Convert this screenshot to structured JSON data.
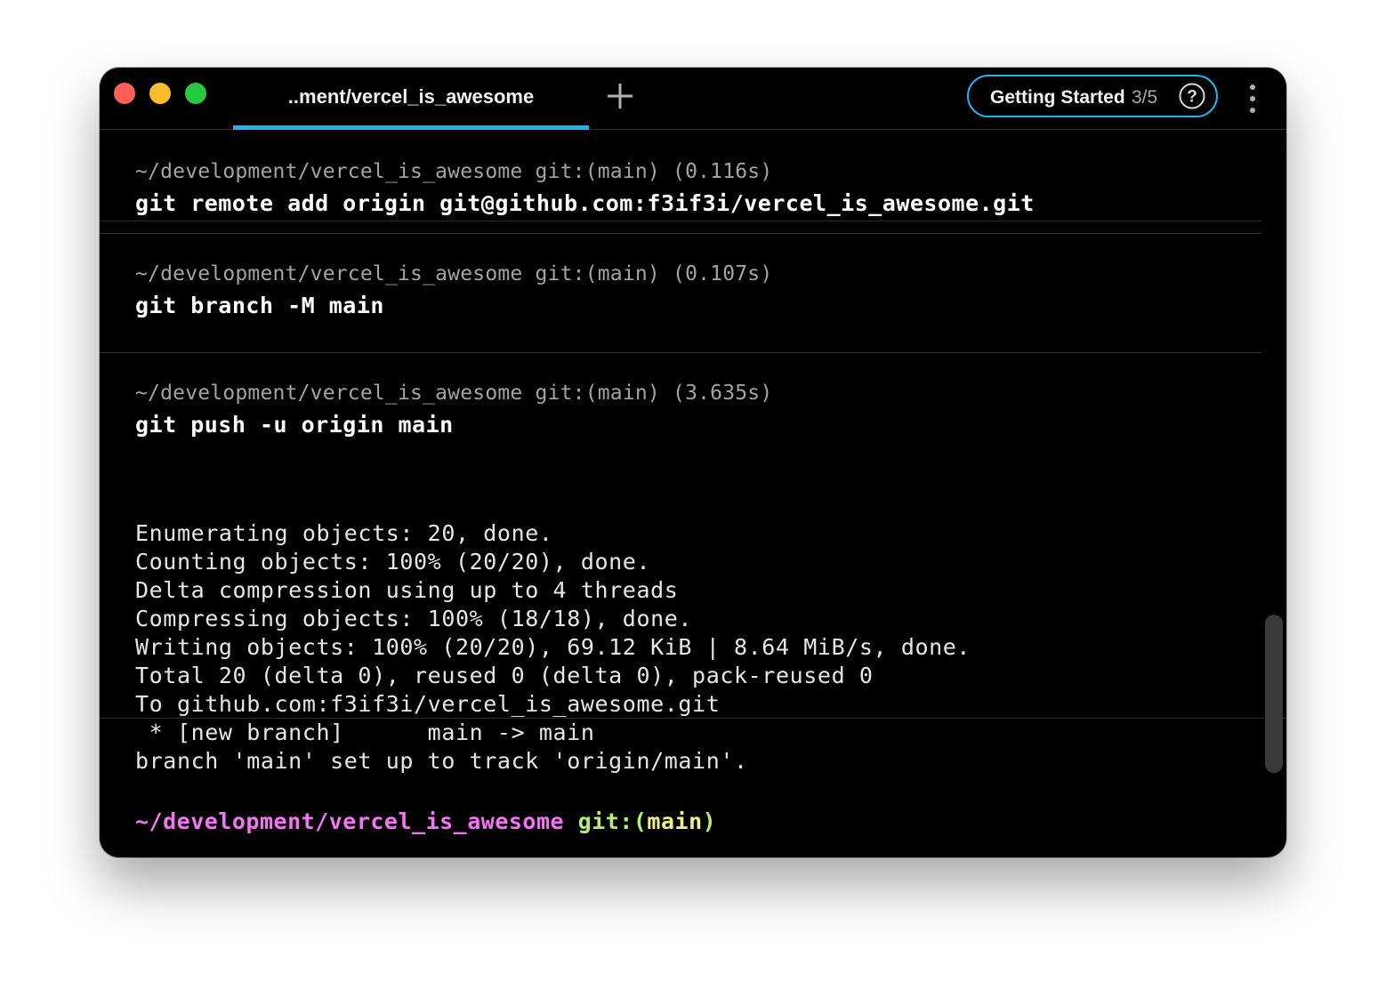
{
  "window": {
    "tab_title": "..ment/vercel_is_awesome",
    "getting_started": {
      "label": "Getting Started",
      "progress": "3/5"
    },
    "colors": {
      "accent": "#1fb4ef",
      "close": "#ff5f57",
      "minimize": "#febc2e",
      "maximize": "#28c840"
    },
    "icons": {
      "new_tab": "plus-icon",
      "help": "question-circle-icon",
      "menu": "vertical-ellipsis-icon"
    }
  },
  "blocks": [
    {
      "prompt": "~/development/vercel_is_awesome git:(main) (0.116s)",
      "command": "git remote add origin git@github.com:f3if3i/vercel_is_awesome.git"
    },
    {
      "prompt": "~/development/vercel_is_awesome git:(main) (0.107s)",
      "command": "git branch -M main"
    },
    {
      "prompt": "~/development/vercel_is_awesome git:(main) (3.635s)",
      "command": "git push -u origin main",
      "output": "Enumerating objects: 20, done.\nCounting objects: 100% (20/20), done.\nDelta compression using up to 4 threads\nCompressing objects: 100% (18/18), done.\nWriting objects: 100% (20/20), 69.12 KiB | 8.64 MiB/s, done.\nTotal 20 (delta 0), reused 0 (delta 0), pack-reused 0\nTo github.com:f3if3i/vercel_is_awesome.git\n * [new branch]      main -> main\nbranch 'main' set up to track 'origin/main'."
    }
  ],
  "active_prompt": {
    "path": "~/development/vercel_is_awesome",
    "git_label": "git:(",
    "branch": "main",
    "git_close": ")"
  }
}
